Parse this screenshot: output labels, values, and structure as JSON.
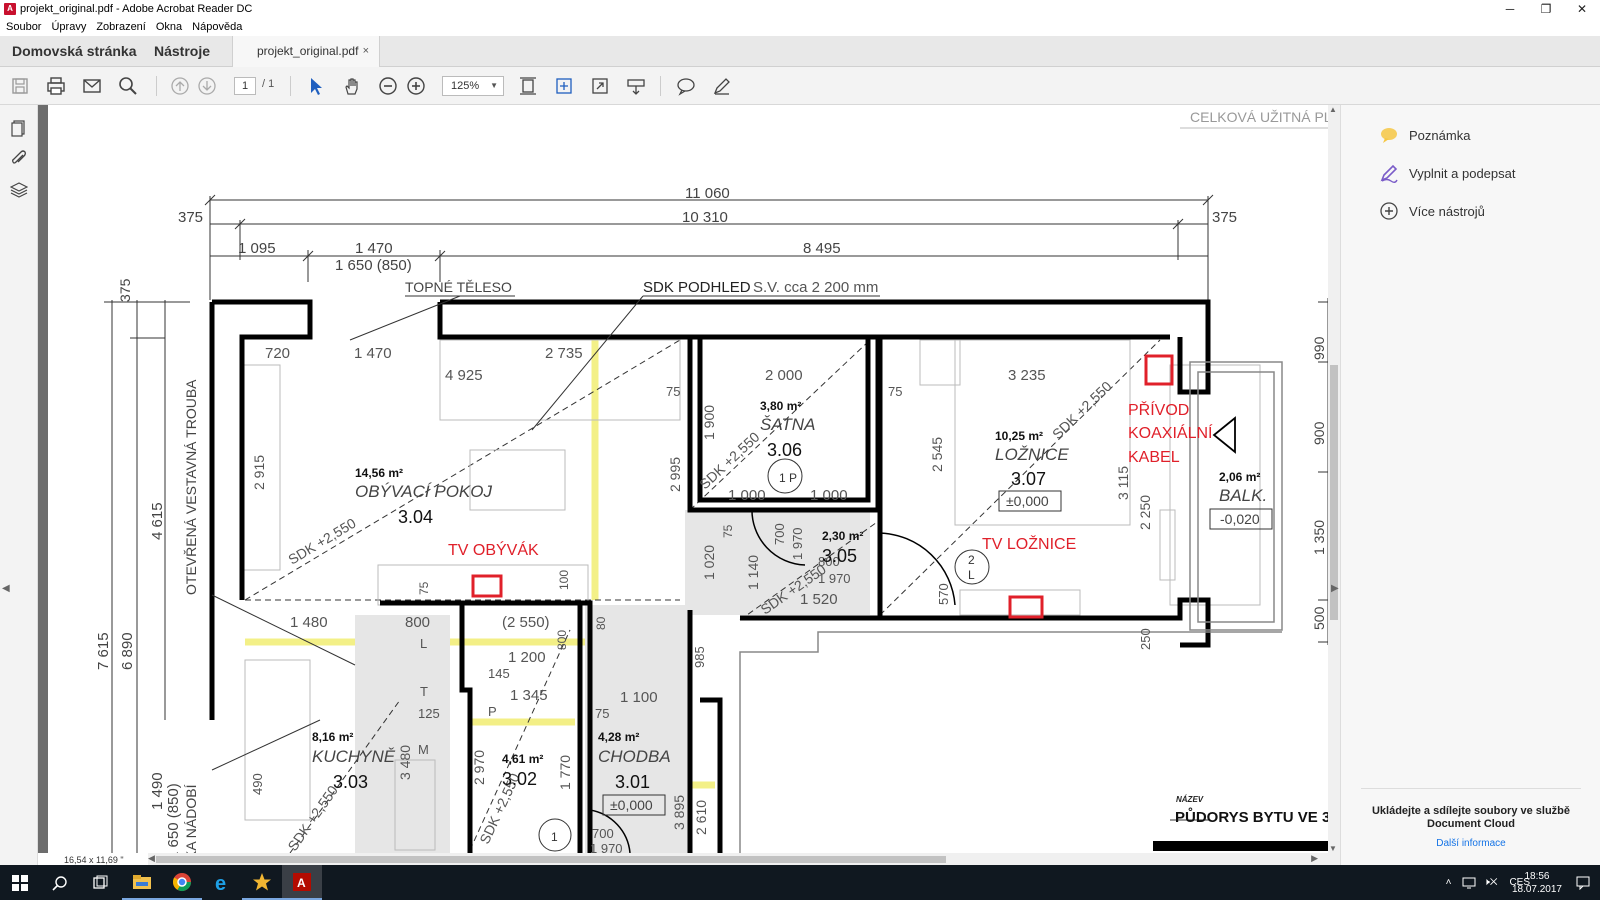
{
  "window": {
    "title": "projekt_original.pdf - Adobe Acrobat Reader DC",
    "controls": {
      "minimize": "─",
      "restore": "❐",
      "close": "✕"
    }
  },
  "menu": [
    "Soubor",
    "Úpravy",
    "Zobrazení",
    "Okna",
    "Nápověda"
  ],
  "nav": {
    "home": "Domovská stránka",
    "tools": "Nástroje",
    "doc_tab": "projekt_original.pdf",
    "doc_tab_close": "×"
  },
  "toolbar": {
    "page_current": "1",
    "page_total": "/ 1",
    "zoom": "125%"
  },
  "status": {
    "dimensions": "16,54 x 11,69 \""
  },
  "right_pane": {
    "items": [
      "Poznámka",
      "Vyplnit a podepsat",
      "Více nástrojů"
    ],
    "promo": "Ukládejte a sdílejte soubory ve službě Document Cloud",
    "promo_link": "Další informace"
  },
  "taskbar": {
    "lang": "CES",
    "time": "18:56",
    "date": "18.07.2017"
  },
  "drawing": {
    "header_right": "CELKOVÁ UŽITNÁ PL",
    "dims_top": {
      "total": "11 060",
      "inner": "10 310",
      "left_offset": "375",
      "right_offset": "375",
      "seg1": "1 095",
      "seg2": "1 470",
      "seg3": "8 495",
      "seg2b": "1 650 (850)"
    },
    "labels": {
      "topne": "TOPNÉ TĚLESO",
      "sdk": "SDK PODHLED",
      "sdk_sv": "S.V. cca 2 200 mm",
      "trouba": "OTEVŘENÁ VESTAVNÁ TROUBA",
      "nadobi": "KA NÁDOBÍ",
      "nazev": "NÁZEV",
      "pudorys": "PŮDORYS BYTU VE 3"
    },
    "rooms": [
      {
        "area": "14,56 m²",
        "name": "OBÝVACÍ POKOJ",
        "num": "3.04"
      },
      {
        "area": "3,80 m²",
        "name": "ŠATNA",
        "num": "3.06"
      },
      {
        "area": "10,25 m²",
        "name": "LOŽNICE",
        "num": "3.07",
        "level": "±0,000"
      },
      {
        "area": "2,06 m²",
        "name": "BALK.",
        "level": "-0,020"
      },
      {
        "area": "2,30 m²",
        "num": "3.05"
      },
      {
        "area": "8,16 m²",
        "name": "KUCHYNĚ",
        "num": "3.03"
      },
      {
        "area": "4,61 m²",
        "num": "3.02"
      },
      {
        "area": "4,28 m²",
        "name": "CHODBA",
        "num": "3.01",
        "level": "±0,000"
      }
    ],
    "annotations": {
      "tv_obyvak": "TV OBÝVÁK",
      "tv_loznice": "TV LOŽNICE",
      "privod1": "PŘÍVOD",
      "privod2": "KOAXIÁLNÍ",
      "privod3": "KABEL"
    },
    "inner_dims": {
      "d720": "720",
      "d1470": "1 470",
      "d2735": "2 735",
      "d4925": "4 925",
      "d75a": "75",
      "d2000": "2 000",
      "d75b": "75",
      "d3235": "3 235",
      "d2915": "2 915",
      "d2995": "2 995",
      "d1900": "1 900",
      "d2545": "2 545",
      "d3115": "3 115",
      "d1000a": "1 000",
      "d1000b": "1 000",
      "d2250": "2 250",
      "d1020": "1 020",
      "d1140": "1 140",
      "d700": "700",
      "d1970a": "1 970",
      "d800a": "800",
      "d1970b": "1 970",
      "d1520": "1 520",
      "d570": "570",
      "d1480": "1 480",
      "d800b": "800",
      "d2550": "(2 550)",
      "d1200": "1 200",
      "d145": "145",
      "d1345": "1 345",
      "d125": "125",
      "d75c": "75",
      "d1100": "1 100",
      "d985": "985",
      "d3480": "3 480",
      "d2970": "2 970",
      "d1770": "1 770",
      "d3895": "3 895",
      "d2610": "2 610",
      "d490": "490",
      "d1490": "1 490",
      "d1650": "1 650 (850)",
      "d700b": "700",
      "d1970c": "1 970",
      "d4615": "4 615",
      "d7615": "7 615",
      "d6890": "6 890",
      "d375v": "375",
      "d990": "990",
      "d900": "900",
      "d1350": "1 350",
      "d500": "500",
      "d250": "250",
      "sdk1": "SDK +2,550",
      "sdk2": "SDK +2,550",
      "sdk3": "SDK +2,550",
      "sdk4": "SDK +2,550",
      "sdk5": "SDK +2,550",
      "sdk6": "SDK +2,550",
      "door1": "1",
      "door1b": "P",
      "door2": "2",
      "door2b": "L",
      "door3": "1",
      "m_T": "T",
      "m_M": "M",
      "m_L": "L",
      "m_P": "P",
      "m_80": "80",
      "m_100": "100",
      "m_75": "75",
      "m_800": "800"
    }
  }
}
